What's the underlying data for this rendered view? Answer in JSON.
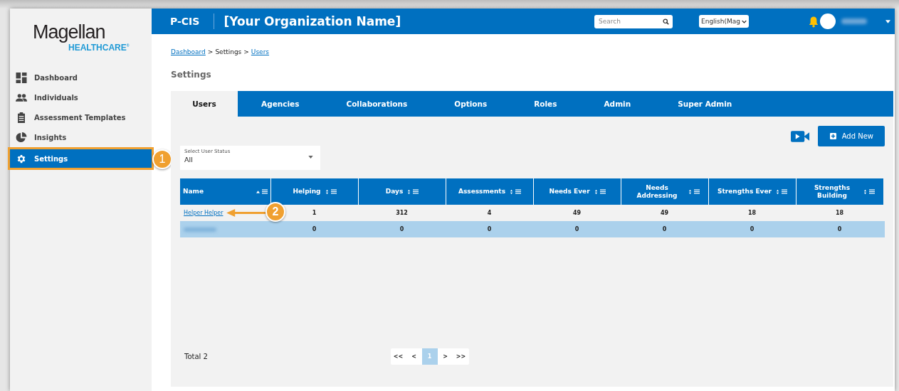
{
  "sidebar": {
    "logo": {
      "name": "Magellan",
      "subtitle": "HEALTHCARE",
      "mark": "®"
    },
    "items": [
      {
        "label": "Dashboard",
        "kind": "dashboard",
        "selected": false
      },
      {
        "label": "Individuals",
        "kind": "people",
        "selected": false
      },
      {
        "label": "Assessment Templates",
        "kind": "clipboard",
        "selected": false
      },
      {
        "label": "Insights",
        "kind": "pie",
        "selected": false
      },
      {
        "label": "Settings",
        "kind": "gear",
        "selected": true,
        "callout": "1"
      }
    ]
  },
  "header": {
    "app": "P-CIS",
    "organization": "[Your Organization Name]",
    "search": {
      "placeholder": "Search"
    },
    "language": "English(Mag"
  },
  "breadcrumb": [
    {
      "label": "Dashboard",
      "kind": "link"
    },
    {
      "label": ">",
      "kind": "separator"
    },
    {
      "label": "Settings",
      "kind": "current"
    },
    {
      "label": ">",
      "kind": "separator"
    },
    {
      "label": "Users",
      "kind": "link"
    }
  ],
  "page_title": "Settings",
  "tabs": [
    {
      "label": "Users",
      "selected": true
    },
    {
      "label": "Agencies",
      "selected": false
    },
    {
      "label": "Collaborations",
      "selected": false
    },
    {
      "label": "Options",
      "selected": false
    },
    {
      "label": "Roles",
      "selected": false
    },
    {
      "label": "Admin",
      "selected": false
    },
    {
      "label": "Super Admin",
      "selected": false
    }
  ],
  "add_button": "Add New",
  "status_select": {
    "label": "Select User Status",
    "value": "All"
  },
  "table": {
    "columns": [
      {
        "label": "Name",
        "kind": "sorted"
      },
      {
        "label": "Helping",
        "kind": "sortable"
      },
      {
        "label": "Days",
        "kind": "sortable"
      },
      {
        "label": "Assessments",
        "kind": "sortable"
      },
      {
        "label": "Needs Ever",
        "kind": "sortable"
      },
      {
        "label": "Needs Addressing",
        "kind": "sortable"
      },
      {
        "label": "Strengths Ever",
        "kind": "sortable"
      },
      {
        "label": "Strengths Building",
        "kind": "sortable"
      }
    ],
    "rows": [
      {
        "callout": "2",
        "selected": false,
        "cells": [
          "Helper Helper",
          "1",
          "312",
          "4",
          "49",
          "49",
          "18",
          "18"
        ]
      },
      {
        "selected": true,
        "cells": [
          "",
          "0",
          "0",
          "0",
          "0",
          "0",
          "0",
          "0"
        ]
      }
    ]
  },
  "total": "Total 2",
  "pagination": [
    {
      "label": "<<",
      "selected": false
    },
    {
      "label": "<",
      "selected": false
    },
    {
      "label": "1",
      "selected": true
    },
    {
      "label": ">",
      "selected": false
    },
    {
      "label": ">>",
      "selected": false
    }
  ]
}
